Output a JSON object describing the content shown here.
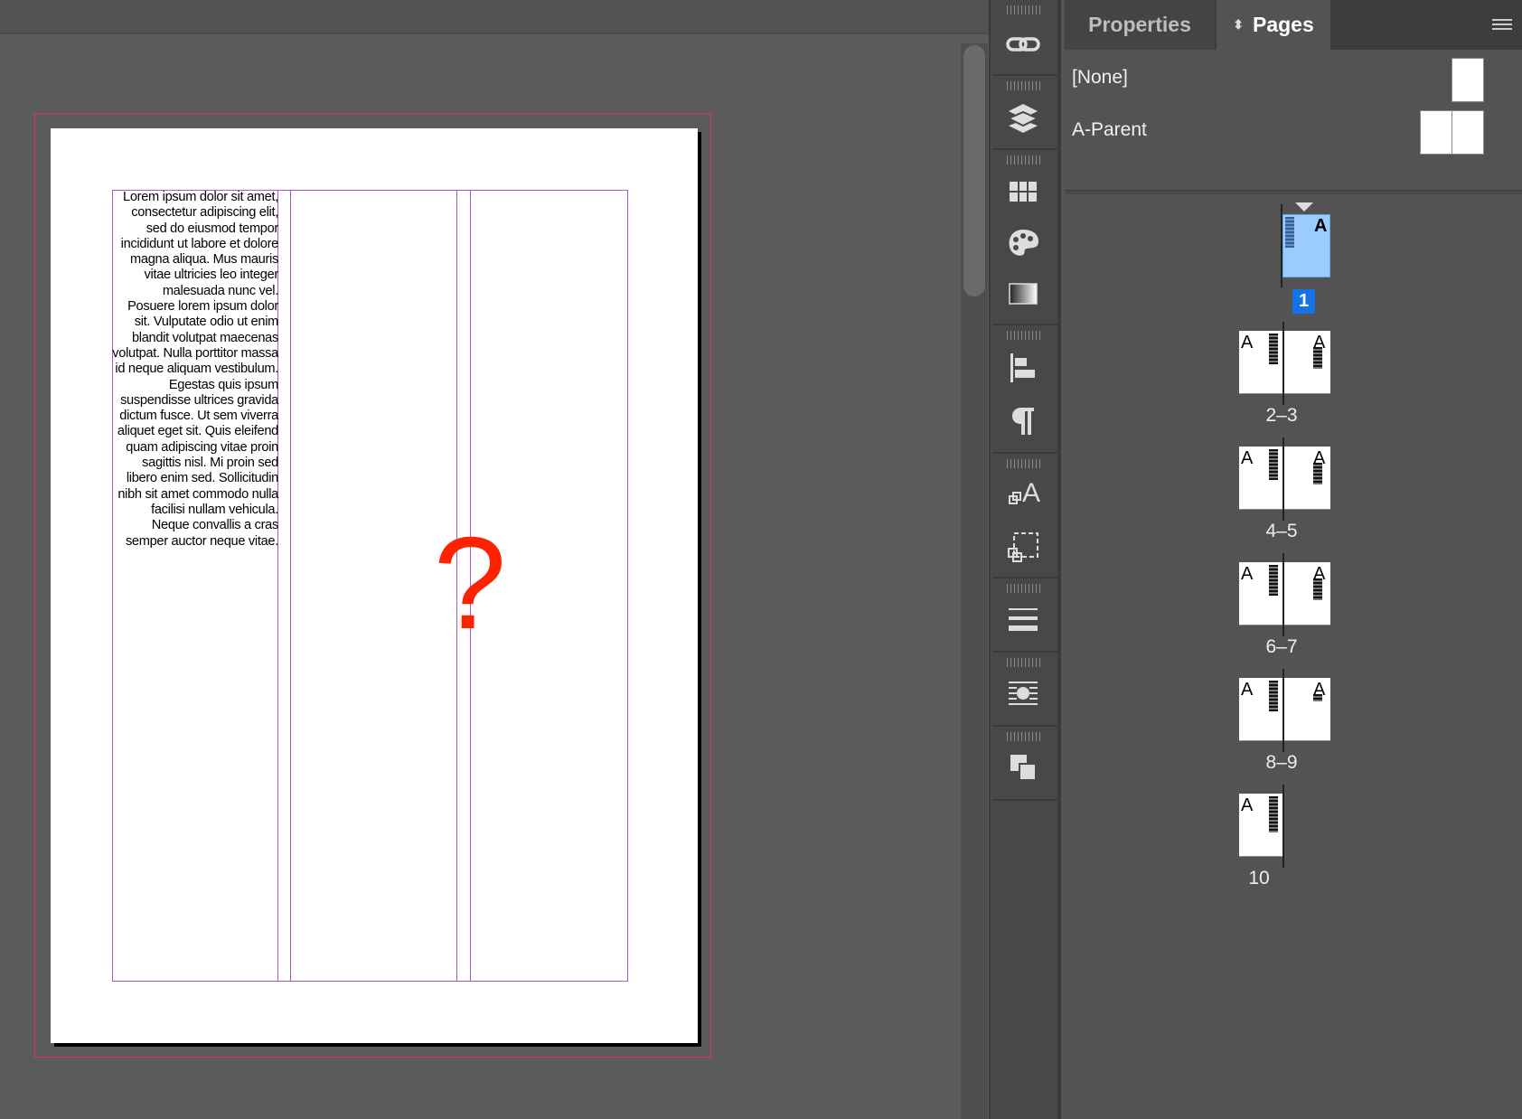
{
  "document": {
    "body_text": "Lorem ipsum dolor sit amet, consectetur adipiscing elit, sed do eiusmod tempor incididunt ut labore et dolore magna aliqua. Mus mauris vitae ultricies leo integer malesuada nunc vel. Posuere lorem ipsum dolor sit. Vulputate odio ut enim blandit volutpat maecenas volutpat. Nulla porttitor massa id neque aliquam vestibulum. Egestas quis ipsum suspendisse ultrices gravida dictum fusce. Ut sem viverra aliquet eget sit. Quis eleifend quam adipiscing vitae proin sagittis nisl. Mi proin sed libero enim sed. Sollicitudin nibh sit amet commodo nulla facilisi nullam vehicula. Neque convallis a cras semper auctor neque vitae.",
    "overlay_symbol": "?",
    "overlay_color": "#ff2200"
  },
  "tool_strip": {
    "icons": [
      "links-icon",
      "layers-icon",
      "swatches-icon",
      "color-palette-icon",
      "gradient-icon",
      "align-icon",
      "paragraph-icon",
      "character-styles-icon",
      "object-styles-icon",
      "stroke-icon",
      "text-wrap-icon",
      "pathfinder-icon"
    ]
  },
  "panel": {
    "tabs": {
      "properties": "Properties",
      "pages": "Pages"
    },
    "parents": [
      {
        "label": "[None]"
      },
      {
        "label": "A-Parent"
      }
    ],
    "page_1_badge": "1",
    "page_letter": "A",
    "spreads": [
      "2–3",
      "4–5",
      "6–7",
      "8–9",
      "10"
    ],
    "selected_color": "#9ccbff",
    "accent_color": "#1473e6"
  }
}
